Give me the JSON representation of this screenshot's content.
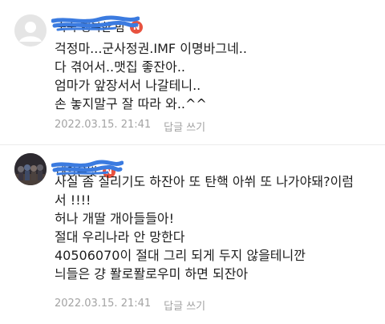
{
  "comments": [
    {
      "author": "숙숙 행복한 밤",
      "badge": "N",
      "lines": [
        "걱정마...군사정권.IMF 이명바그네..",
        "다 겪어서..맷집 좋잔아..",
        "엄마가 앞장서서 나갈테니..",
        "손 놓지말구 잘 따라 와..^^"
      ],
      "date": "2022.03.15. 21:41",
      "reply_label": "답글 쓰기"
    },
    {
      "author": "태양은빛",
      "badge": "N",
      "lines": [
        "사실 좀 질리기도 하잔아 또 탄핵 아쒸 또 나가야돼?이럼",
        "서 !!!!",
        "허나 개딸 개아들들아!",
        "절대 우리나라 안 망한다",
        "40506070이 절대 그리 되게 두지 않을테니깐",
        "늬들은 걍 퐐로퐐로우미 하면 되잔아"
      ],
      "date": "2022.03.15. 21:41",
      "reply_label": "답글 쓰기"
    }
  ],
  "colors": {
    "badge": "#e8523f",
    "scribble": "#3b7be0",
    "meta_text": "#a3a3a3"
  },
  "icons": [
    "default-avatar-icon",
    "new-badge-icon",
    "profile-photo"
  ]
}
